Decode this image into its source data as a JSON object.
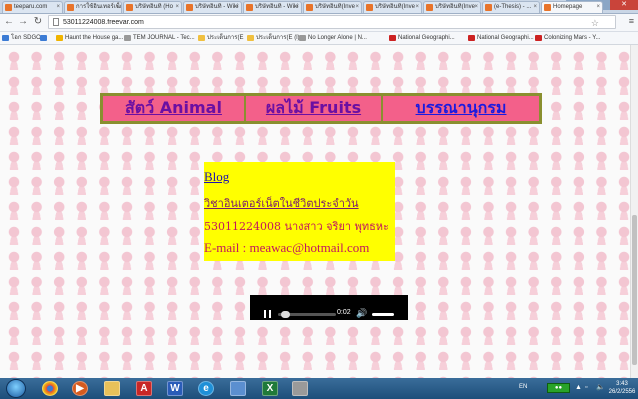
{
  "browser": {
    "tabs": [
      {
        "label": "teeparu.com"
      },
      {
        "label": "การใช้อินเทอร์เน็ต"
      },
      {
        "label": "บริษัทอินทิ (Ho"
      },
      {
        "label": "บริษัทอินทิ - Wiki"
      },
      {
        "label": "บริษัทอินทิ - Wiki"
      },
      {
        "label": "บริษัทอินทิ(Inve"
      },
      {
        "label": "บริษัทอินทิ(Inve"
      },
      {
        "label": "บริษัทอินทิ(Inve"
      },
      {
        "label": "(e-Thesis) - ..."
      },
      {
        "label": "Homepage",
        "active": true
      }
    ],
    "url": "53011224008.freevar.com",
    "bookmarks": [
      {
        "label": "โอก SDGO",
        "color": "#3b7bd4"
      },
      {
        "label": "",
        "color": "#3b7bd4"
      },
      {
        "label": "Haunt the House ga...",
        "color": "#f0b400"
      },
      {
        "label": "TEM JOURNAL - Tec...",
        "color": "#999999"
      },
      {
        "label": "ประเด็นการ(E",
        "color": "#f0c040"
      },
      {
        "label": "ประเด็นการ(E (l)",
        "color": "#f0c040"
      },
      {
        "label": "No Longer Alone | N...",
        "color": "#999999"
      },
      {
        "label": "National Geographi...",
        "color": "#cc2222"
      },
      {
        "label": "National Geographi...",
        "color": "#cc2222"
      },
      {
        "label": "Colonizing Mars - Y...",
        "color": "#cc2222"
      }
    ]
  },
  "page": {
    "nav": {
      "animal": "สัตว์ Animal",
      "fruits": "ผลไม้ Fruits",
      "bibliography": "บรรณานุกรม"
    },
    "info": {
      "blog": "Blog",
      "course": "วิชาอินเตอร์เน็ตในชีวิตประจำวัน",
      "student": "53011224008 นางสาว จริยา พุทธหะ",
      "email": "E-mail : meawac@hotmail.com"
    },
    "player": {
      "time": "0:02",
      "progress": 0.05
    }
  },
  "taskbar": {
    "language": "EN",
    "clock_time": "3:43",
    "clock_date": "26/2/2556"
  },
  "colors": {
    "nav_bg": "#f3608a",
    "info_bg": "#ffff00"
  }
}
